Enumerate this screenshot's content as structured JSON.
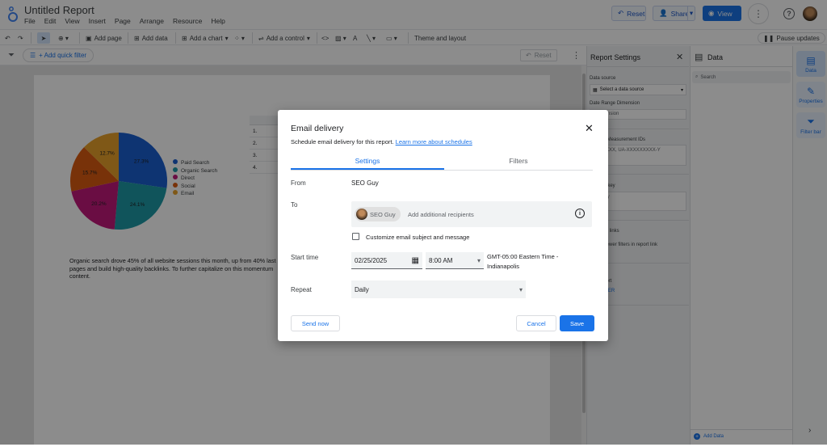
{
  "app": {
    "title": "Untitled Report",
    "menu": [
      "File",
      "Edit",
      "View",
      "Insert",
      "Page",
      "Arrange",
      "Resource",
      "Help"
    ],
    "reset_label": "Reset",
    "share_label": "Share",
    "view_label": "View"
  },
  "toolbar": {
    "add_page": "Add page",
    "add_data": "Add data",
    "add_chart": "Add a chart",
    "add_control": "Add a control",
    "theme": "Theme and layout",
    "pause": "Pause updates"
  },
  "filterbar": {
    "add_filter": "+ Add quick filter",
    "reset": "Reset"
  },
  "report": {
    "pie_labels": [
      "27.3%",
      "24.1%",
      "20.2%",
      "15.7%",
      "12.7%"
    ],
    "legend": [
      "Paid Search",
      "Organic Search",
      "Direct",
      "Social",
      "Email"
    ],
    "table_rows": [
      "1.",
      "2.",
      "3.",
      "4."
    ],
    "text_line1": "Organic search drove 45% of all website sessions this month, up from 40% last",
    "text_line2": "pages and build high-quality backlinks. To further capitalize on this momentum",
    "text_line3": "content."
  },
  "chart_data": {
    "type": "pie",
    "categories": [
      "Paid Search",
      "Organic Search",
      "Direct",
      "Social",
      "Email"
    ],
    "values": [
      27.3,
      24.1,
      20.2,
      15.7,
      12.7
    ],
    "colors": [
      "#1a5fd0",
      "#1e9aa7",
      "#c2187a",
      "#db5c12",
      "#e8a02a"
    ]
  },
  "report_settings": {
    "title": "Report Settings",
    "data_source_label": "Data source",
    "data_source_value": "Select a data source",
    "date_range_label": "Date Range Dimension",
    "date_range_value": "d dimension",
    "analytics_label": "nalytics Measurement IDs",
    "analytics_value": "XXXXXXX, UA-XXXXXXXXX-Y",
    "maps_label": "aps API key",
    "maps_value": "API key",
    "bookmark_label": "ookmark links",
    "bookmark_value": "nable viewer filters in report link",
    "filter_label": "his Report",
    "filter_value": "D A FILTER"
  },
  "data_panel": {
    "title": "Data",
    "search_placeholder": "Search",
    "add_data": "Add Data"
  },
  "rail": {
    "data": "Data",
    "properties": "Properties",
    "filter_bar": "Filter bar"
  },
  "modal": {
    "title": "Email delivery",
    "subtitle": "Schedule email delivery for this report.",
    "learn_more": "Learn more about schedules",
    "tab_settings": "Settings",
    "tab_filters": "Filters",
    "from_label": "From",
    "from_value": "SEO Guy",
    "to_label": "To",
    "recipient_chip": "SEO Guy",
    "recipient_placeholder": "Add additional recipients",
    "customize_label": "Customize email subject and message",
    "start_label": "Start time",
    "start_date": "02/25/2025",
    "start_time": "8:00 AM",
    "timezone_line1": "GMT-05:00 Eastern Time -",
    "timezone_line2": "Indianapolis",
    "repeat_label": "Repeat",
    "repeat_value": "Daily",
    "send_now": "Send now",
    "cancel": "Cancel",
    "save": "Save"
  }
}
